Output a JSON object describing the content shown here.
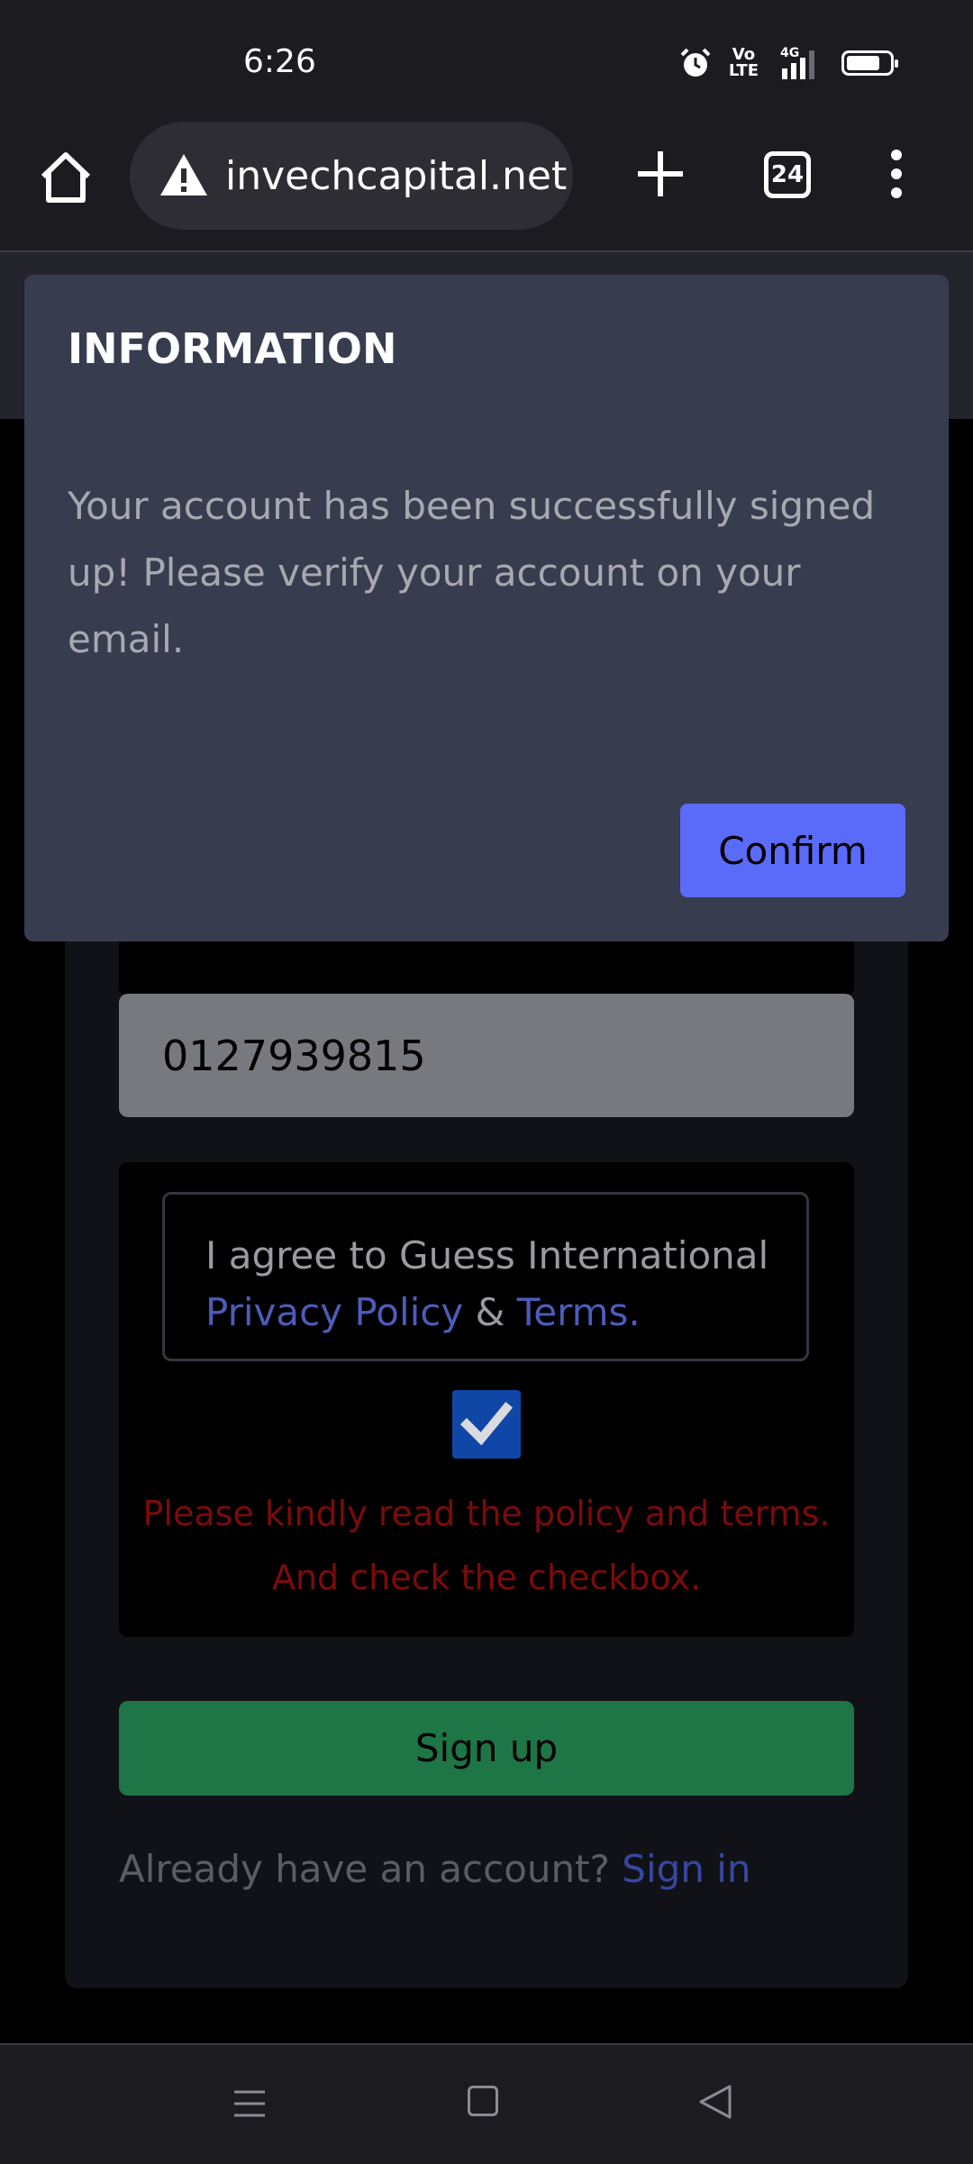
{
  "status_bar": {
    "time": "6:26",
    "net_vo": "Vo",
    "net_lte": "LTE",
    "net_gen": "4G",
    "icons": [
      "alarm-icon",
      "volte-icon",
      "signal-icon",
      "battery-icon"
    ]
  },
  "browser": {
    "url": "invechcapital.net",
    "tab_count": "24",
    "icons": [
      "home-icon",
      "warning-icon",
      "plus-icon",
      "menu-dots-icon"
    ]
  },
  "form": {
    "phone_value": "0127939815",
    "agree_text": "I agree to Guess International",
    "privacy_link": "Privacy Policy",
    "amp": "&",
    "terms_link": "Terms.",
    "checkbox_checked": true,
    "error_message": "Please kindly read the policy and terms. And check the checkbox.",
    "signup_label": "Sign up",
    "already_text": "Already have an account?",
    "signin_link": "Sign in"
  },
  "dialog": {
    "title": "INFORMATION",
    "message": "Your account has been successfully signed up! Please verify your account on your email.",
    "confirm_label": "Confirm"
  },
  "colors": {
    "dialog_bg": "#383c4f",
    "confirm_button": "#5b6bf9",
    "signup_button": "#1e7545",
    "error_text": "#7b0b0b",
    "link": "#4d5bb8",
    "checkbox": "#1046a6"
  }
}
